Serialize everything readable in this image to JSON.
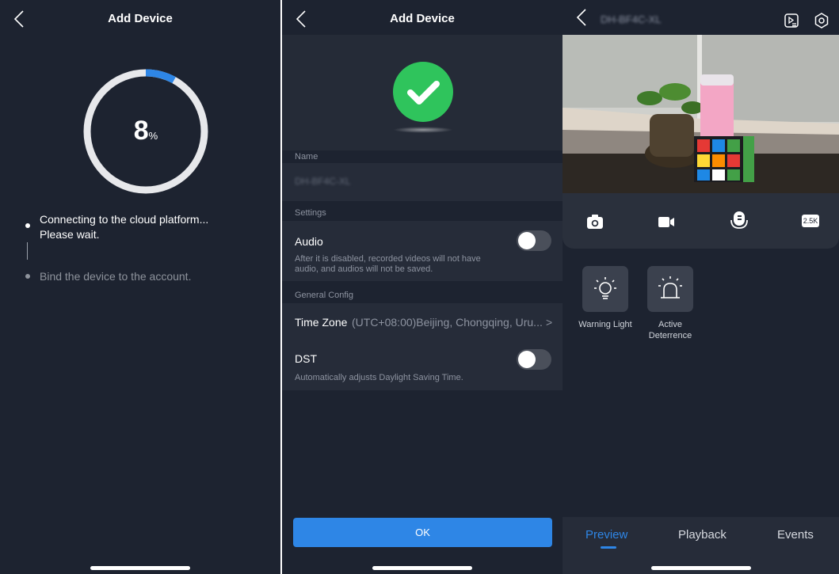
{
  "panel_connect": {
    "title": "Add Device",
    "progress": {
      "value": 8,
      "unit": "%",
      "fraction": 0.08
    },
    "steps": [
      {
        "line1": "Connecting to the cloud platform...",
        "line2": "Please wait.",
        "state": "active"
      },
      {
        "line1": "Bind the device to the account.",
        "state": "pending"
      }
    ]
  },
  "panel_settings": {
    "title": "Add Device",
    "success_icon": "check-circle-icon",
    "name_section_label": "Name",
    "device_name": "DH-BF4C-XL",
    "settings_section_label": "Settings",
    "audio": {
      "label": "Audio",
      "description_line1": "After it is disabled, recorded videos will not have",
      "description_line2": "audio, and audios will not be saved.",
      "enabled": false
    },
    "general_section_label": "General Config",
    "time_zone": {
      "label": "Time Zone",
      "value": "(UTC+08:00)Beijing, Chongqing, Uru...",
      "chevron": ">"
    },
    "dst": {
      "label": "DST",
      "description": "Automatically adjusts Daylight Saving Time.",
      "enabled": false
    },
    "ok_label": "OK"
  },
  "panel_preview": {
    "device_name": "DH-BF4C-XL",
    "header_icons": [
      "playback-list-icon",
      "settings-icon"
    ],
    "controls": [
      "snapshot-icon",
      "record-icon",
      "talk-icon"
    ],
    "resolution_label": "2.5K",
    "features": [
      {
        "label": "Warning Light",
        "icon": "bulb-icon"
      },
      {
        "label_line1": "Active",
        "label_line2": "Deterrence",
        "icon": "siren-icon"
      }
    ],
    "tabs": [
      {
        "label": "Preview",
        "active": true
      },
      {
        "label": "Playback",
        "active": false
      },
      {
        "label": "Events",
        "active": false
      }
    ],
    "colors": {
      "accent": "#2e86e6",
      "success": "#2fc45c",
      "background": "#1d2330"
    }
  }
}
